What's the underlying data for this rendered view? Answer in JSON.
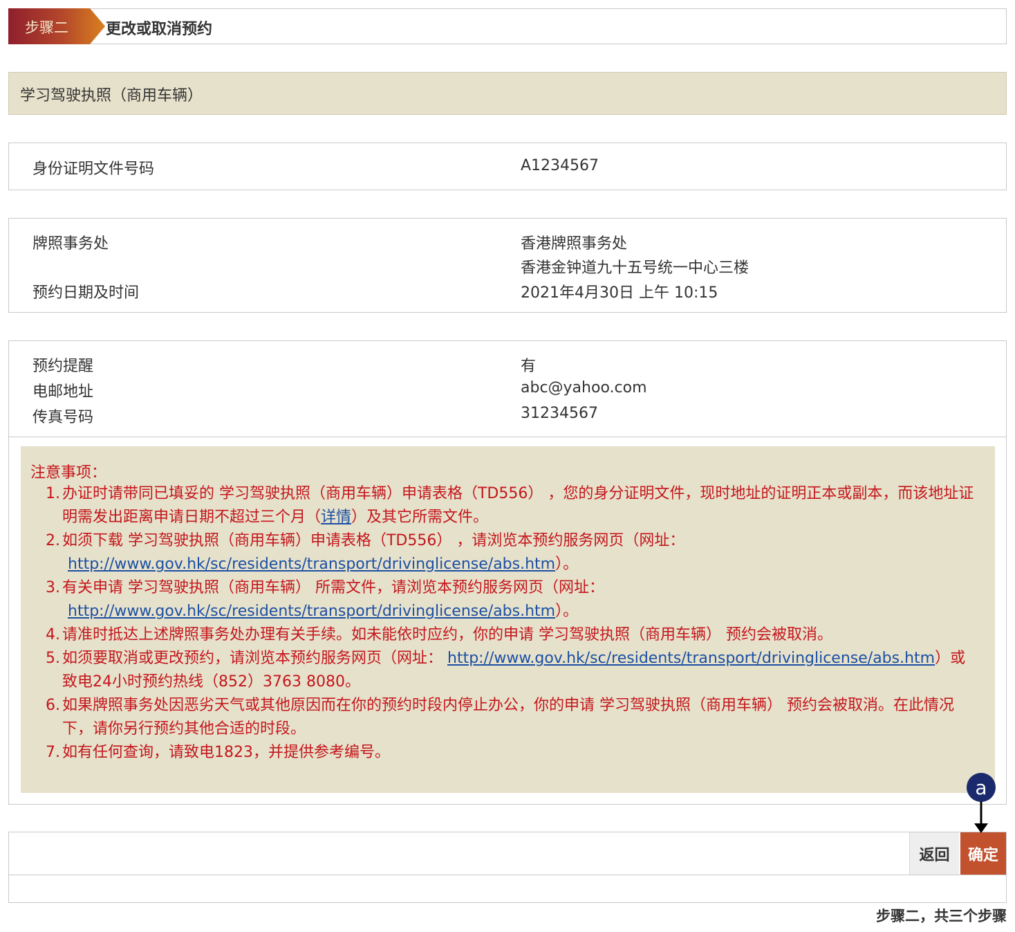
{
  "step": {
    "tag": "步骤二",
    "title": "更改或取消预约"
  },
  "licence_type": "学习驾驶执照（商用车辆）",
  "identity": {
    "label": "身份证明文件号码",
    "value": "A1234567"
  },
  "office": {
    "office_label": "牌照事务处",
    "office_name": "香港牌照事务处",
    "office_address": "香港金钟道九十五号统一中心三楼",
    "datetime_label": "预约日期及时间",
    "datetime_value": "2021年4月30日 上午 10:15"
  },
  "contact": {
    "reminder_label": "预约提醒",
    "reminder_value": "有",
    "email_label": "电邮地址",
    "email_value": "abc@yahoo.com",
    "fax_label": "传真号码",
    "fax_value": "31234567"
  },
  "notes": {
    "title": "注意事项：",
    "items": [
      {
        "num": "1.",
        "text_a": "办证时请带同已填妥的 学习驾驶执照（商用车辆）申请表格（TD556） ，您的身分证明文件，现时地址的证明正本或副本，而该地址证明需发出距离申请日期不超过三个月（",
        "link": "详情",
        "text_b": "）及其它所需文件。"
      },
      {
        "num": "2.",
        "text_a": "如须下载 学习驾驶执照（商用车辆）申请表格（TD556） ，请浏览本预约服务网页（网址：",
        "link": "http://www.gov.hk/sc/residents/transport/drivinglicense/abs.htm",
        "text_b": "）。"
      },
      {
        "num": "3.",
        "text_a": "有关申请 学习驾驶执照（商用车辆） 所需文件，请浏览本预约服务网页（网址：",
        "link": "http://www.gov.hk/sc/residents/transport/drivinglicense/abs.htm",
        "text_b": "）。"
      },
      {
        "num": "4.",
        "text_a": "请准时抵达上述牌照事务处办理有关手续。如未能依时应约，你的申请 学习驾驶执照（商用车辆） 预约会被取消。"
      },
      {
        "num": "5.",
        "text_a": "如须要取消或更改预约，请浏览本预约服务网页（网址： ",
        "link": "http://www.gov.hk/sc/residents/transport/drivinglicense/abs.htm",
        "text_b": "）或致电24小时预约热线（852）3763 8080。"
      },
      {
        "num": "6.",
        "text_a": "如果牌照事务处因恶劣天气或其他原因而在你的预约时段内停止办公，你的申请 学习驾驶执照（商用车辆） 预约会被取消。在此情况下，请你另行预约其他合适的时段。"
      },
      {
        "num": "7.",
        "text_a": "如有任何查询，请致电1823，并提供参考编号。"
      }
    ]
  },
  "actions": {
    "back_label": "返回",
    "confirm_label": "确定"
  },
  "step_count": "步骤二，共三个步骤",
  "annotation": {
    "marker": "a"
  },
  "colors": {
    "accent": "#c2512e",
    "notes_text": "#c4161c",
    "notes_bg": "#e6e1cb",
    "link": "#1b4fa3",
    "marker": "#1a2a6c"
  }
}
